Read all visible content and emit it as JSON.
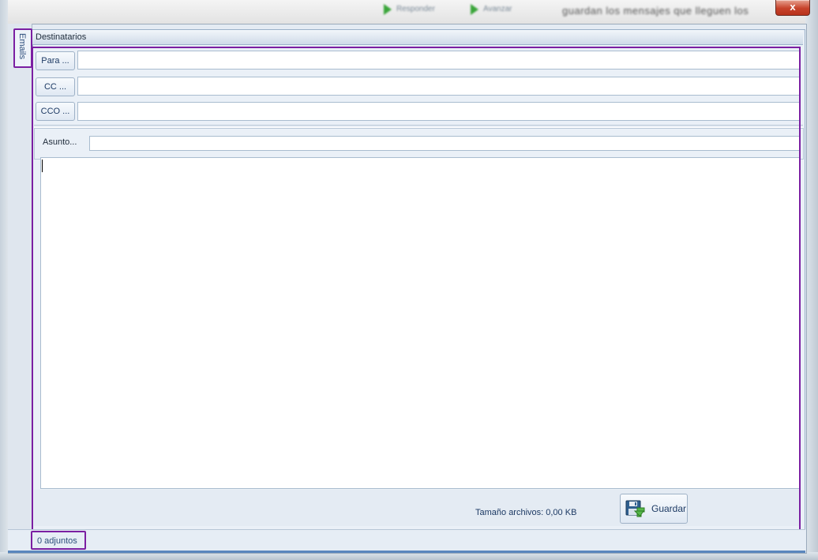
{
  "background": {
    "buttons": [
      {
        "label": "Responder"
      },
      {
        "label": "Avanzar"
      }
    ],
    "text": "guardan los mensajes que lleguen los"
  },
  "window": {
    "close_label": "x"
  },
  "side_tab": {
    "label": "Emails"
  },
  "panel": {
    "title": "Destinatarios",
    "recipients": [
      {
        "label": "Para ...",
        "value": ""
      },
      {
        "label": "CC ...",
        "value": ""
      },
      {
        "label": "CCO ...",
        "value": ""
      }
    ],
    "subject_label": "Asunto...",
    "subject_value": "",
    "body_value": ""
  },
  "footer": {
    "size_label": "Tamaño archivos: 0,00 KB",
    "save_label": "Guardar"
  },
  "status": {
    "attachments_label": "0 adjuntos"
  },
  "colors": {
    "highlight": "#7b1fa2",
    "accent": "#5a86bd"
  }
}
